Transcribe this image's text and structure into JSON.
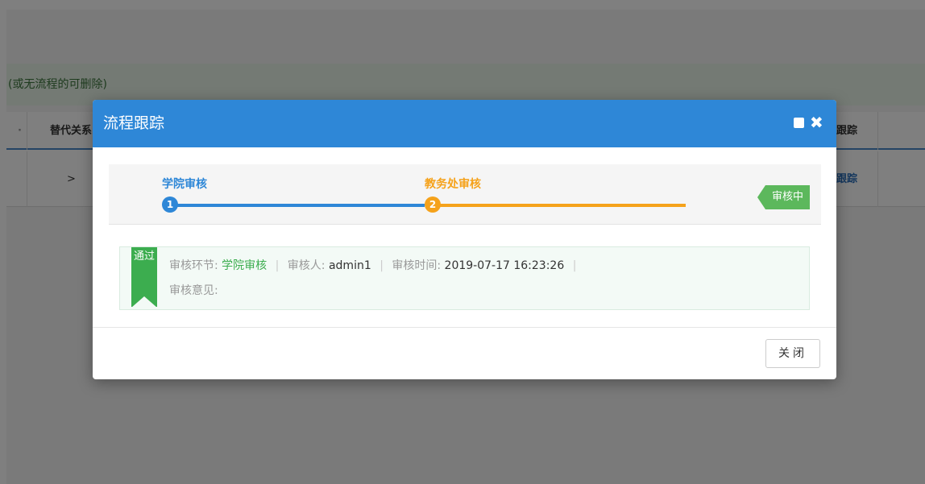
{
  "background": {
    "notice_text": "(或无流程的可删除)",
    "table": {
      "header_col_a": "·",
      "header_col_b": "替代关系",
      "header_col_c": "跟踪",
      "row_col_b": ">",
      "row_col_c": "跟踪"
    }
  },
  "modal": {
    "title": "流程跟踪",
    "icons": {
      "maximize": "square-icon",
      "close": "close-icon"
    },
    "steps": [
      {
        "number": "1",
        "label": "学院审核",
        "color": "#2e87d7"
      },
      {
        "number": "2",
        "label": "教务处审核",
        "color": "#f5a21b"
      }
    ],
    "status_tag": "审核中",
    "record": {
      "result_badge": "通过",
      "stage_label": "审核环节:",
      "stage_value": "学院审核",
      "reviewer_label": "审核人:",
      "reviewer_value": "admin1",
      "time_label": "审核时间:",
      "time_value": "2019-07-17 16:23:26",
      "opinion_label": "审核意见:"
    },
    "footer": {
      "close_label": "关闭"
    }
  },
  "colors": {
    "header_blue": "#2e87d7",
    "step_orange": "#f5a21b",
    "status_green": "#5cb85c",
    "pass_green": "#3cad4f"
  }
}
